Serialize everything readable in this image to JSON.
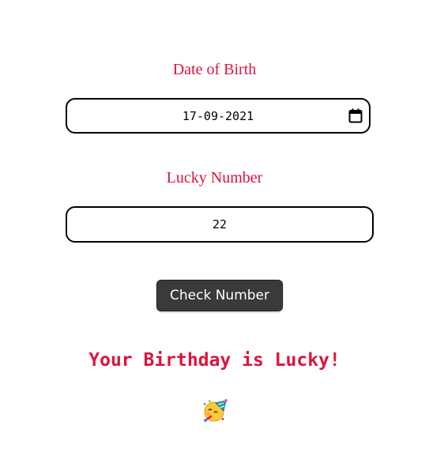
{
  "form": {
    "dob_label": "Date of Birth",
    "dob_value": "17-09-2021",
    "lucky_label": "Lucky Number",
    "lucky_value": "22",
    "check_button_label": "Check Number"
  },
  "result": {
    "message": "Your Birthday is Lucky!",
    "emoji_icon": "partying-face-icon"
  },
  "colors": {
    "accent": "#dc143c",
    "button_bg": "#3a3a3a",
    "field_border": "#000000"
  }
}
